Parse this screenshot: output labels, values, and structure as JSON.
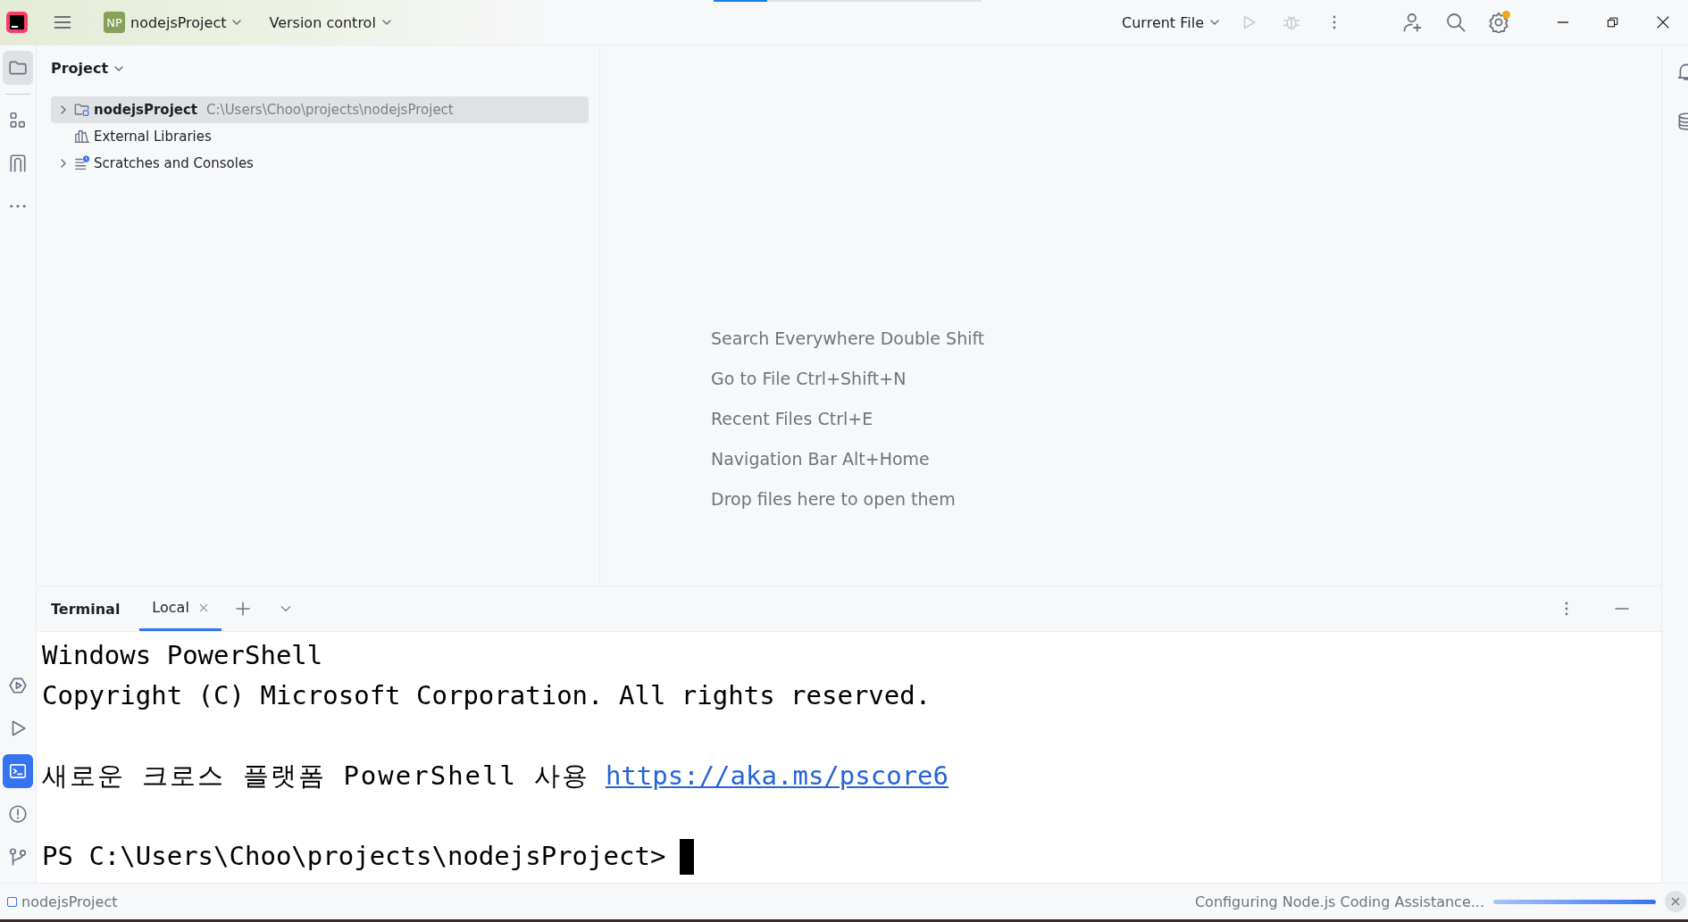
{
  "title_bar": {
    "project_badge": "NP",
    "project_name": "nodejsProject",
    "vcs": "Version control",
    "run_config": "Current File",
    "run_enabled": false,
    "debug_enabled": false,
    "settings_notification": true
  },
  "top_progress": {
    "level": 0.2
  },
  "left_toolbar": {
    "top": [
      {
        "kind": "project",
        "selected": true
      },
      {
        "kind": "structure",
        "selected": false
      },
      {
        "kind": "bookmarks",
        "selected": false
      },
      {
        "kind": "more",
        "selected": false
      }
    ],
    "bottom": [
      {
        "kind": "services",
        "selected": false
      },
      {
        "kind": "run",
        "selected": false
      },
      {
        "kind": "terminal",
        "selected": true
      },
      {
        "kind": "problems",
        "selected": false
      },
      {
        "kind": "git",
        "selected": false
      }
    ]
  },
  "project_panel": {
    "title": "Project",
    "tree": [
      {
        "kind": "project",
        "name": "nodejsProject",
        "path": "C:\\Users\\Choo\\projects\\nodejsProject",
        "expandable": true,
        "expanded": false,
        "selected": true
      },
      {
        "kind": "libraries",
        "name": "External Libraries",
        "expandable": false,
        "selected": false
      },
      {
        "kind": "scratches",
        "name": "Scratches and Consoles",
        "expandable": true,
        "expanded": false,
        "selected": false
      }
    ]
  },
  "editor_hints": [
    "Search Everywhere Double Shift",
    "Go to File Ctrl+Shift+N",
    "Recent Files Ctrl+E",
    "Navigation Bar Alt+Home",
    "Drop files here to open them"
  ],
  "terminal": {
    "title": "Terminal",
    "tabs": [
      {
        "label": "Local",
        "selected": true
      }
    ],
    "lines": [
      {
        "kind": "text",
        "text": "Windows PowerShell"
      },
      {
        "kind": "text",
        "text": "Copyright (C) Microsoft Corporation. All rights reserved."
      },
      {
        "kind": "blank"
      },
      {
        "kind": "link_line",
        "text": "새로운 크로스 플랫폼 PowerShell 사용",
        "link": "https://aka.ms/pscore6"
      },
      {
        "kind": "blank"
      },
      {
        "kind": "prompt",
        "text": "PS C:\\Users\\Choo\\projects\\nodejsProject>",
        "cursor": true
      }
    ]
  },
  "right_toolbar": [
    {
      "kind": "notifications"
    },
    {
      "kind": "database"
    }
  ],
  "status_bar": {
    "breadcrumb": "nodejsProject",
    "task": "Configuring Node.js Coding Assistance...",
    "progress": {
      "level": 1
    }
  }
}
